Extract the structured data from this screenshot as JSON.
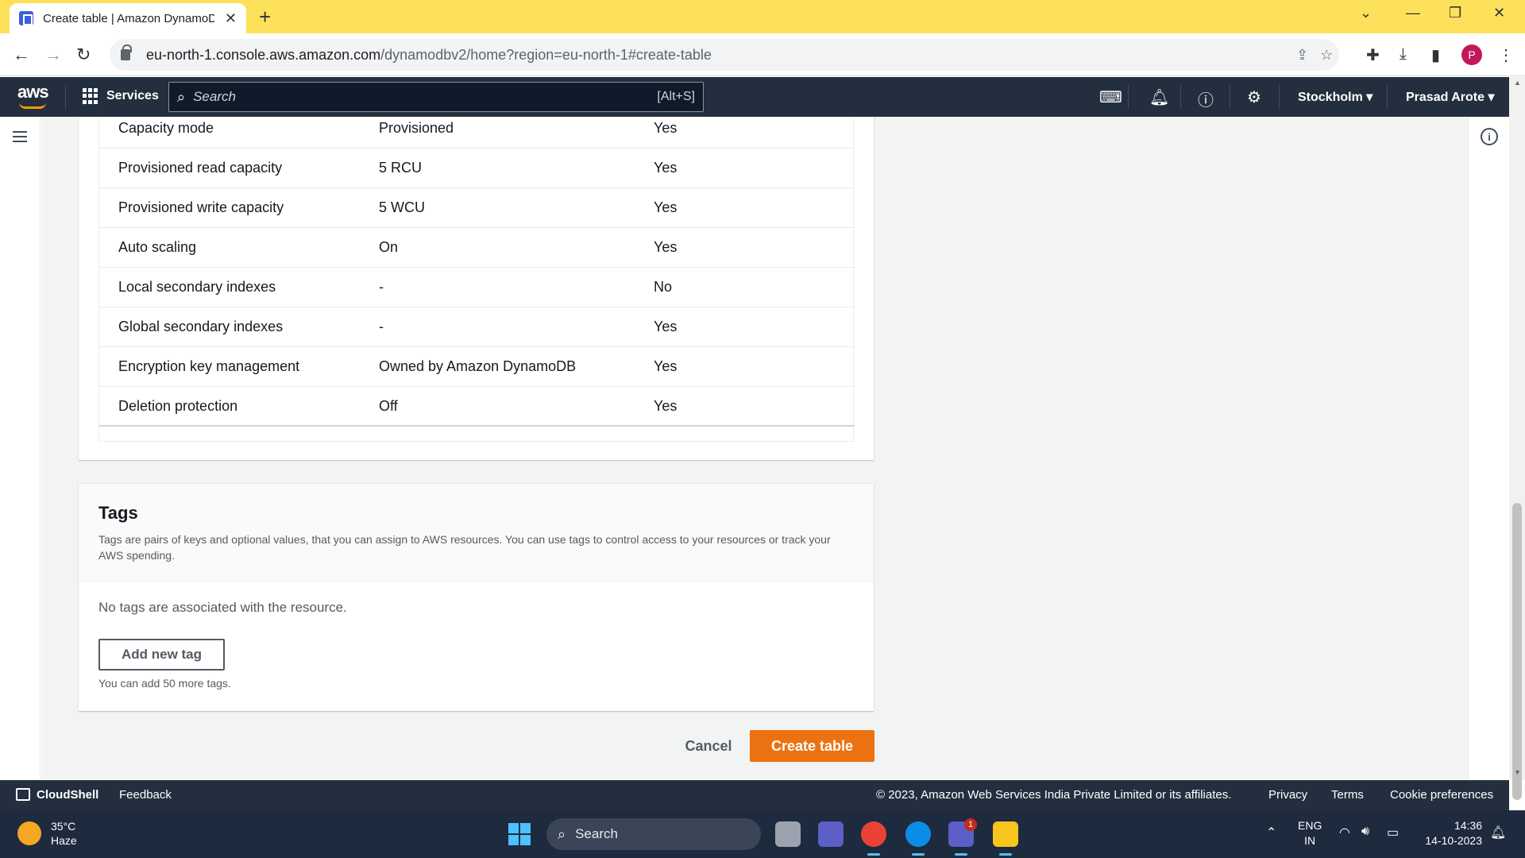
{
  "browser": {
    "tab_title": "Create table | Amazon DynamoDB",
    "url_host": "eu-north-1.console.aws.amazon.com",
    "url_path": "/dynamodbv2/home?region=eu-north-1#create-table",
    "profile_initial": "P"
  },
  "aws_header": {
    "logo": "aws",
    "services_label": "Services",
    "search_placeholder": "Search",
    "search_shortcut": "[Alt+S]",
    "region": "Stockholm",
    "user": "Prasad Arote"
  },
  "settings_table": {
    "rows": [
      {
        "name": "Capacity mode",
        "value": "Provisioned",
        "editable": "Yes"
      },
      {
        "name": "Provisioned read capacity",
        "value": "5 RCU",
        "editable": "Yes"
      },
      {
        "name": "Provisioned write capacity",
        "value": "5 WCU",
        "editable": "Yes"
      },
      {
        "name": "Auto scaling",
        "value": "On",
        "editable": "Yes"
      },
      {
        "name": "Local secondary indexes",
        "value": "-",
        "editable": "No"
      },
      {
        "name": "Global secondary indexes",
        "value": "-",
        "editable": "Yes"
      },
      {
        "name": "Encryption key management",
        "value": "Owned by Amazon DynamoDB",
        "editable": "Yes"
      },
      {
        "name": "Deletion protection",
        "value": "Off",
        "editable": "Yes"
      }
    ]
  },
  "tags": {
    "title": "Tags",
    "description": "Tags are pairs of keys and optional values, that you can assign to AWS resources. You can use tags to control access to your resources or track your AWS spending.",
    "empty_message": "No tags are associated with the resource.",
    "add_button": "Add new tag",
    "limit_message": "You can add 50 more tags."
  },
  "actions": {
    "cancel": "Cancel",
    "create": "Create table"
  },
  "footer": {
    "cloudshell": "CloudShell",
    "feedback": "Feedback",
    "copyright": "© 2023, Amazon Web Services India Private Limited or its affiliates.",
    "privacy": "Privacy",
    "terms": "Terms",
    "cookie": "Cookie preferences"
  },
  "taskbar": {
    "temperature": "35°C",
    "weather": "Haze",
    "search": "Search",
    "language": "ENG",
    "locale": "IN",
    "time": "14:36",
    "date": "14-10-2023",
    "teams_badge": "1"
  },
  "colors": {
    "primary_button": "#ec7211",
    "aws_nav": "#232f3e",
    "tab_bar": "#fde15a"
  }
}
